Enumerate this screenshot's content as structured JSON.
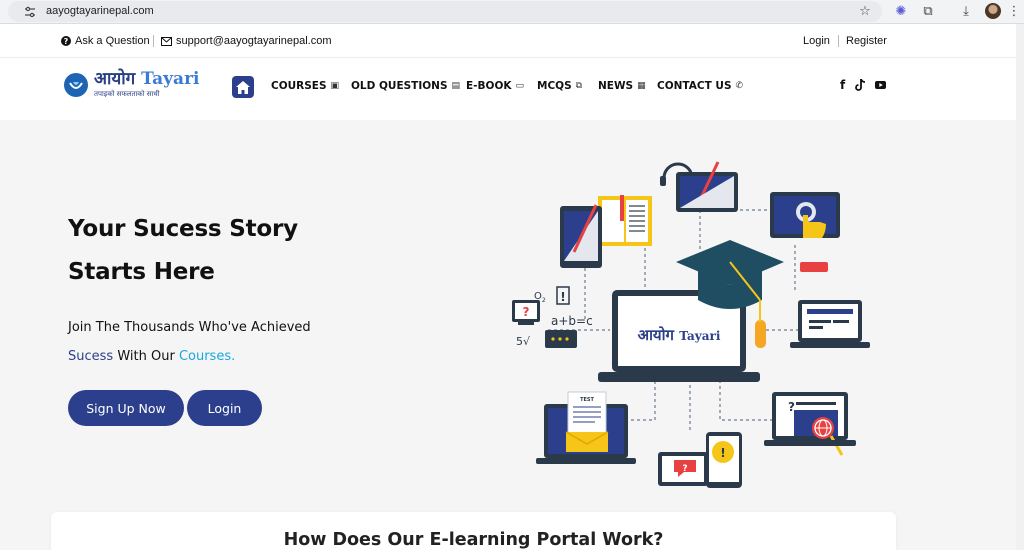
{
  "browser": {
    "url": "aayogtayarinepal.com",
    "icons": [
      "tune-icon",
      "star-icon",
      "extension-icon",
      "puzzle-icon",
      "download-icon",
      "profile-avatar",
      "menu-icon"
    ]
  },
  "topbar": {
    "ask_question": "Ask a Question",
    "email": "support@aayogtayarinepal.com",
    "login": "Login",
    "register": "Register"
  },
  "logo": {
    "devanagari": "आयोग",
    "latin": "Tayari",
    "tagline": "तपाइको सफलताको साथी"
  },
  "nav": {
    "items": [
      {
        "label": "COURSES",
        "icon": "book-icon"
      },
      {
        "label": "OLD QUESTIONS",
        "icon": "paper-icon"
      },
      {
        "label": "E-BOOK",
        "icon": "laptop-icon"
      },
      {
        "label": "MCQS",
        "icon": "copy-icon"
      },
      {
        "label": "NEWS",
        "icon": "newspaper-icon"
      },
      {
        "label": "CONTACT US",
        "icon": "phone-icon"
      }
    ],
    "social": [
      "facebook-icon",
      "tiktok-icon",
      "youtube-icon"
    ]
  },
  "hero": {
    "title_line1": "Your Sucess Story",
    "title_line2": "Starts Here",
    "desc_line1": "Join The Thousands Who've Achieved",
    "desc_line2_a": "Sucess",
    "desc_line2_b": "With Our",
    "desc_line2_c": "Courses.",
    "signup_button": "Sign Up Now",
    "login_button": "Login"
  },
  "illustration": {
    "screen_brand_devanagari": "आयोग",
    "screen_brand_latin": "Tayari",
    "o2": "O",
    "o2_sub": "2",
    "formula": "a+b=c",
    "sqrt": "5√",
    "test_label": "TEST",
    "question_mark": "?",
    "exclamation": "!"
  },
  "section": {
    "title": "How Does Our E-learning Portal Work?"
  },
  "colors": {
    "primary": "#2b3f8c",
    "accent": "#19a7e0",
    "hero_bg": "#f5f5f5"
  }
}
